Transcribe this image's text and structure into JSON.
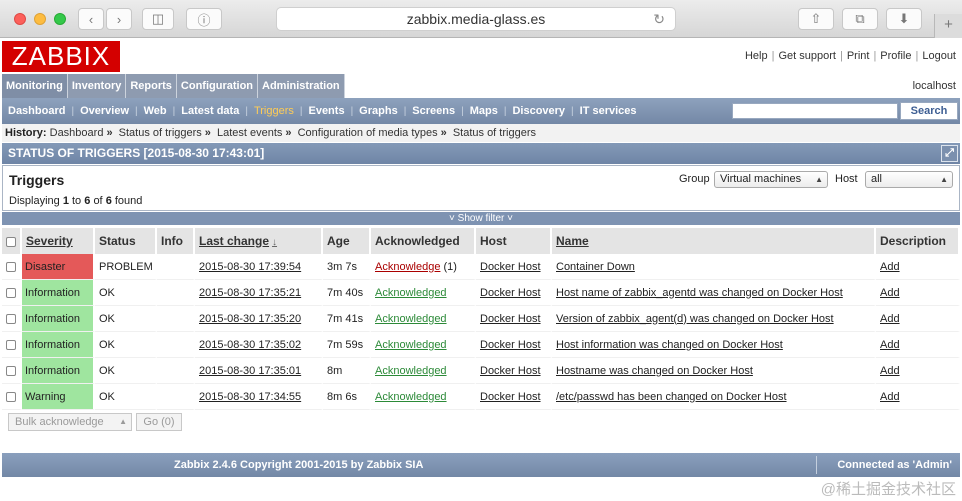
{
  "browser": {
    "url": "zabbix.media-glass.es",
    "reload_icon": "reload-icon",
    "new_tab_label": "+"
  },
  "header": {
    "logo": "ZABBIX",
    "links": [
      "Help",
      "Get support",
      "Print",
      "Profile",
      "Logout"
    ],
    "server": "localhost"
  },
  "main_menu": [
    "Monitoring",
    "Inventory",
    "Reports",
    "Configuration",
    "Administration"
  ],
  "sub_menu": [
    "Dashboard",
    "Overview",
    "Web",
    "Latest data",
    "Triggers",
    "Events",
    "Graphs",
    "Screens",
    "Maps",
    "Discovery",
    "IT services"
  ],
  "search": {
    "button": "Search"
  },
  "history": {
    "label": "History:",
    "items": [
      "Dashboard",
      "Status of triggers",
      "Latest events",
      "Configuration of media types",
      "Status of triggers"
    ]
  },
  "page_title": "STATUS OF TRIGGERS [2015-08-30 17:43:01]",
  "filter": {
    "title": "Triggers",
    "displaying_prefix": "Displaying",
    "from": "1",
    "to_word": "to",
    "to": "6",
    "of_word": "of",
    "total": "6",
    "found_word": "found",
    "group_label": "Group",
    "group_value": "Virtual machines",
    "host_label": "Host",
    "host_value": "all",
    "show_filter": "Show filter"
  },
  "table": {
    "headers": {
      "severity": "Severity",
      "status": "Status",
      "info": "Info",
      "last_change": "Last change",
      "age": "Age",
      "acknowledged": "Acknowledged",
      "host": "Host",
      "name": "Name",
      "description": "Description"
    },
    "rows": [
      {
        "severity": "Disaster",
        "status": "PROBLEM",
        "last_change": "2015-08-30 17:39:54",
        "age": "3m 7s",
        "ack": "Acknowledge",
        "ack_count": "(1)",
        "host": "Docker Host",
        "name": "Container Down",
        "desc": "Add"
      },
      {
        "severity": "Information",
        "status": "OK",
        "last_change": "2015-08-30 17:35:21",
        "age": "7m 40s",
        "ack": "Acknowledged",
        "ack_count": "",
        "host": "Docker Host",
        "name": "Host name of zabbix_agentd was changed on Docker Host",
        "desc": "Add"
      },
      {
        "severity": "Information",
        "status": "OK",
        "last_change": "2015-08-30 17:35:20",
        "age": "7m 41s",
        "ack": "Acknowledged",
        "ack_count": "",
        "host": "Docker Host",
        "name": "Version of zabbix_agent(d) was changed on Docker Host",
        "desc": "Add"
      },
      {
        "severity": "Information",
        "status": "OK",
        "last_change": "2015-08-30 17:35:02",
        "age": "7m 59s",
        "ack": "Acknowledged",
        "ack_count": "",
        "host": "Docker Host",
        "name": "Host information was changed on Docker Host",
        "desc": "Add"
      },
      {
        "severity": "Information",
        "status": "OK",
        "last_change": "2015-08-30 17:35:01",
        "age": "8m",
        "ack": "Acknowledged",
        "ack_count": "",
        "host": "Docker Host",
        "name": "Hostname was changed on Docker Host",
        "desc": "Add"
      },
      {
        "severity": "Warning",
        "status": "OK",
        "last_change": "2015-08-30 17:34:55",
        "age": "8m 6s",
        "ack": "Acknowledged",
        "ack_count": "",
        "host": "Docker Host",
        "name": "/etc/passwd has been changed on Docker Host",
        "desc": "Add"
      }
    ]
  },
  "actions": {
    "bulk": "Bulk acknowledge",
    "go": "Go (0)"
  },
  "footer": {
    "copyright": "Zabbix 2.4.6 Copyright 2001-2015 by Zabbix SIA",
    "connected": "Connected as 'Admin'"
  },
  "watermark": "@稀土掘金技术社区",
  "colors": {
    "disaster": "#e45959",
    "ok_severity": "#9fe59f",
    "ok_status": "#1b7a2a",
    "logo_red": "#d40000",
    "menu_blue": "#7388a6"
  }
}
